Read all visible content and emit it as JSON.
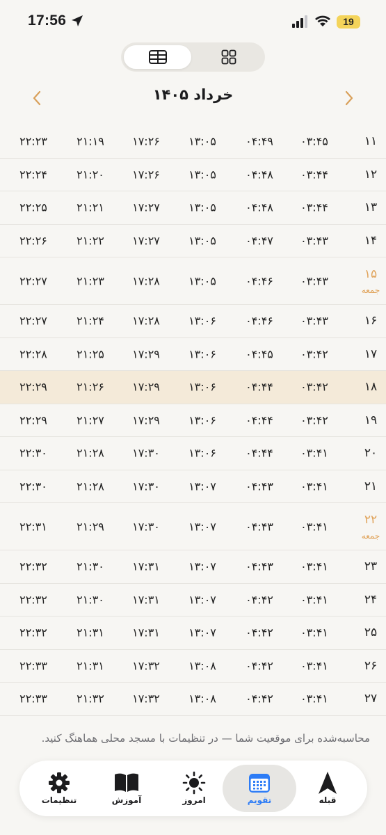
{
  "status_bar": {
    "time": "17:56",
    "battery": "19"
  },
  "header": {
    "month_title": "خرداد ۱۴۰۵"
  },
  "colors": {
    "accent_blue": "#2d7cf6",
    "friday_orange": "#e0a35a",
    "highlight_row": "#f4ead9",
    "nav_chevron": "#d9a05a"
  },
  "icons": {
    "view_table": "table-icon",
    "view_grid": "grid-icon",
    "prev": "chevron-left-icon",
    "next": "chevron-right-icon"
  },
  "rows": [
    {
      "day": "۱۱",
      "note": "",
      "times": [
        "۰۳:۴۵",
        "۰۴:۴۹",
        "۱۳:۰۵",
        "۱۷:۲۶",
        "۲۱:۱۹",
        "۲۲:۲۳"
      ]
    },
    {
      "day": "۱۲",
      "note": "",
      "times": [
        "۰۳:۴۴",
        "۰۴:۴۸",
        "۱۳:۰۵",
        "۱۷:۲۶",
        "۲۱:۲۰",
        "۲۲:۲۴"
      ]
    },
    {
      "day": "۱۳",
      "note": "",
      "times": [
        "۰۳:۴۴",
        "۰۴:۴۸",
        "۱۳:۰۵",
        "۱۷:۲۷",
        "۲۱:۲۱",
        "۲۲:۲۵"
      ]
    },
    {
      "day": "۱۴",
      "note": "",
      "times": [
        "۰۳:۴۳",
        "۰۴:۴۷",
        "۱۳:۰۵",
        "۱۷:۲۷",
        "۲۱:۲۲",
        "۲۲:۲۶"
      ]
    },
    {
      "day": "۱۵",
      "note": "جمعه",
      "times": [
        "۰۳:۴۳",
        "۰۴:۴۶",
        "۱۳:۰۵",
        "۱۷:۲۸",
        "۲۱:۲۳",
        "۲۲:۲۷"
      ]
    },
    {
      "day": "۱۶",
      "note": "",
      "times": [
        "۰۳:۴۳",
        "۰۴:۴۶",
        "۱۳:۰۶",
        "۱۷:۲۸",
        "۲۱:۲۴",
        "۲۲:۲۷"
      ]
    },
    {
      "day": "۱۷",
      "note": "",
      "times": [
        "۰۳:۴۲",
        "۰۴:۴۵",
        "۱۳:۰۶",
        "۱۷:۲۹",
        "۲۱:۲۵",
        "۲۲:۲۸"
      ]
    },
    {
      "day": "۱۸",
      "note": "",
      "today": true,
      "times": [
        "۰۳:۴۲",
        "۰۴:۴۴",
        "۱۳:۰۶",
        "۱۷:۲۹",
        "۲۱:۲۶",
        "۲۲:۲۹"
      ]
    },
    {
      "day": "۱۹",
      "note": "",
      "times": [
        "۰۳:۴۲",
        "۰۴:۴۴",
        "۱۳:۰۶",
        "۱۷:۲۹",
        "۲۱:۲۷",
        "۲۲:۲۹"
      ]
    },
    {
      "day": "۲۰",
      "note": "",
      "times": [
        "۰۳:۴۱",
        "۰۴:۴۴",
        "۱۳:۰۶",
        "۱۷:۳۰",
        "۲۱:۲۸",
        "۲۲:۳۰"
      ]
    },
    {
      "day": "۲۱",
      "note": "",
      "times": [
        "۰۳:۴۱",
        "۰۴:۴۳",
        "۱۳:۰۷",
        "۱۷:۳۰",
        "۲۱:۲۸",
        "۲۲:۳۰"
      ]
    },
    {
      "day": "۲۲",
      "note": "جمعه",
      "times": [
        "۰۳:۴۱",
        "۰۴:۴۳",
        "۱۳:۰۷",
        "۱۷:۳۰",
        "۲۱:۲۹",
        "۲۲:۳۱"
      ]
    },
    {
      "day": "۲۳",
      "note": "",
      "times": [
        "۰۳:۴۱",
        "۰۴:۴۳",
        "۱۳:۰۷",
        "۱۷:۳۱",
        "۲۱:۳۰",
        "۲۲:۳۲"
      ]
    },
    {
      "day": "۲۴",
      "note": "",
      "times": [
        "۰۳:۴۱",
        "۰۴:۴۲",
        "۱۳:۰۷",
        "۱۷:۳۱",
        "۲۱:۳۰",
        "۲۲:۳۲"
      ]
    },
    {
      "day": "۲۵",
      "note": "",
      "times": [
        "۰۳:۴۱",
        "۰۴:۴۲",
        "۱۳:۰۷",
        "۱۷:۳۱",
        "۲۱:۳۱",
        "۲۲:۳۲"
      ]
    },
    {
      "day": "۲۶",
      "note": "",
      "times": [
        "۰۳:۴۱",
        "۰۴:۴۲",
        "۱۳:۰۸",
        "۱۷:۳۲",
        "۲۱:۳۱",
        "۲۲:۳۳"
      ]
    },
    {
      "day": "۲۷",
      "note": "",
      "times": [
        "۰۳:۴۱",
        "۰۴:۴۲",
        "۱۳:۰۸",
        "۱۷:۳۲",
        "۲۱:۳۲",
        "۲۲:۳۳"
      ]
    }
  ],
  "footnote": "محاسبه‌شده برای موقعیت شما — در تنظیمات با مسجد محلی هماهنگ کنید.",
  "tabbar": {
    "tabs": [
      {
        "label": "تنظیمات",
        "icon": "gear-icon"
      },
      {
        "label": "آموزش",
        "icon": "book-icon"
      },
      {
        "label": "امروز",
        "icon": "sun-icon"
      },
      {
        "label": "تقویم",
        "icon": "calendar-icon",
        "active": true
      },
      {
        "label": "قبله",
        "icon": "compass-arrow-icon"
      }
    ]
  }
}
